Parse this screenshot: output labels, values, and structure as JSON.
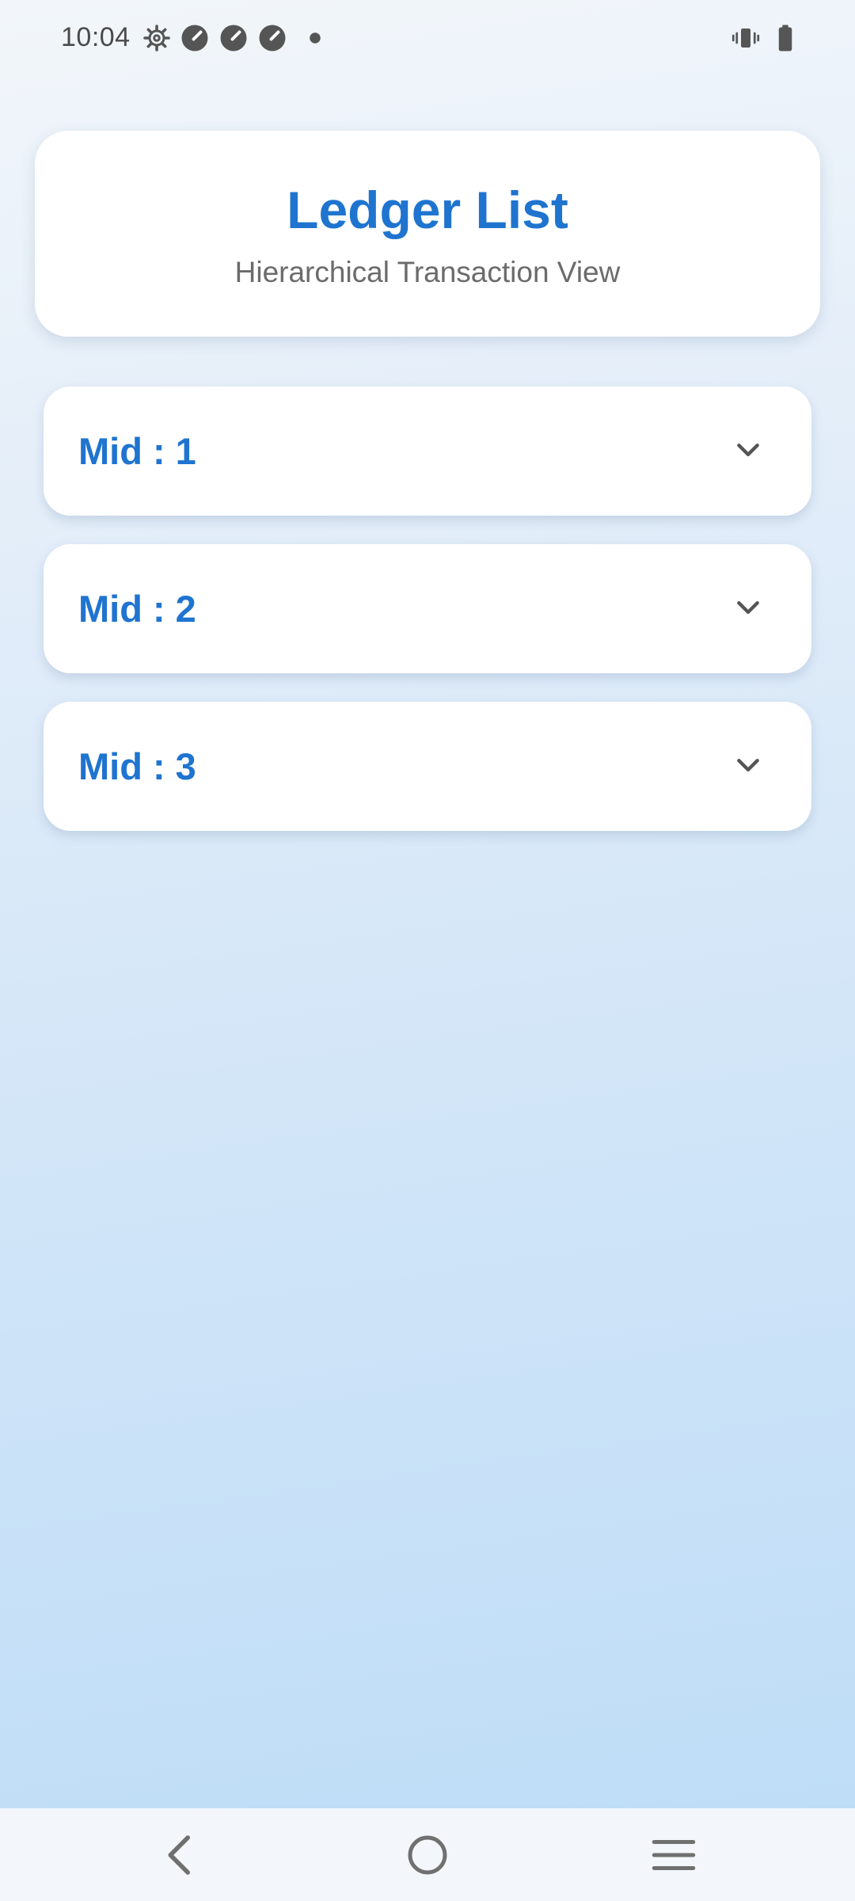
{
  "status_bar": {
    "time": "10:04",
    "left_icons": [
      "settings-gear-icon",
      "speedometer-icon",
      "speedometer-icon",
      "speedometer-icon",
      "dot-icon"
    ],
    "right_icons": [
      "vibrate-icon",
      "battery-icon"
    ]
  },
  "header": {
    "title": "Ledger List",
    "subtitle": "Hierarchical Transaction View"
  },
  "list": {
    "items": [
      {
        "label": "Mid : 1",
        "icon": "chevron-down-icon"
      },
      {
        "label": "Mid : 2",
        "icon": "chevron-down-icon"
      },
      {
        "label": "Mid : 3",
        "icon": "chevron-down-icon"
      }
    ]
  },
  "nav_bar": {
    "icons": [
      "back-icon",
      "home-icon",
      "recents-icon"
    ]
  },
  "colors": {
    "accent": "#1f74cf",
    "subtitle": "#6b6b6b",
    "background_top": "#f2f6fa",
    "background_bottom": "#bcdcf7"
  }
}
